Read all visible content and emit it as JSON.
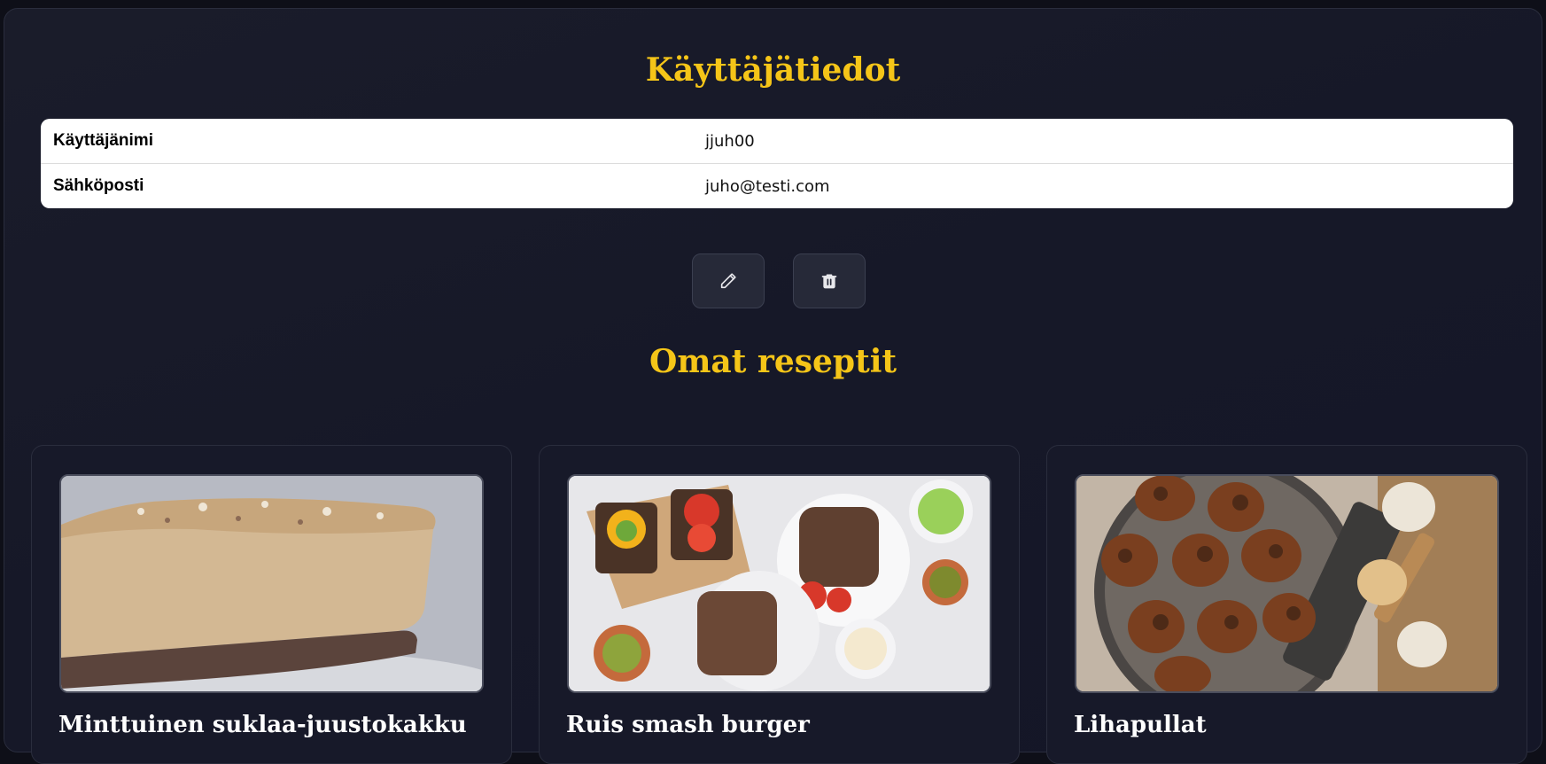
{
  "user_section": {
    "title": "Käyttäjätiedot",
    "rows": [
      {
        "label": "Käyttäjänimi",
        "value": "jjuh00"
      },
      {
        "label": "Sähköposti",
        "value": "juho@testi.com"
      }
    ]
  },
  "actions": {
    "edit_icon": "pencil-icon",
    "delete_icon": "trash-icon"
  },
  "recipes_section": {
    "title": "Omat reseptit",
    "recipes": [
      {
        "title": "Minttuinen suklaa-juustokakku"
      },
      {
        "title": "Ruis smash burger"
      },
      {
        "title": "Lihapullat"
      }
    ]
  },
  "colors": {
    "accent": "#f5c518",
    "background": "#161828"
  }
}
